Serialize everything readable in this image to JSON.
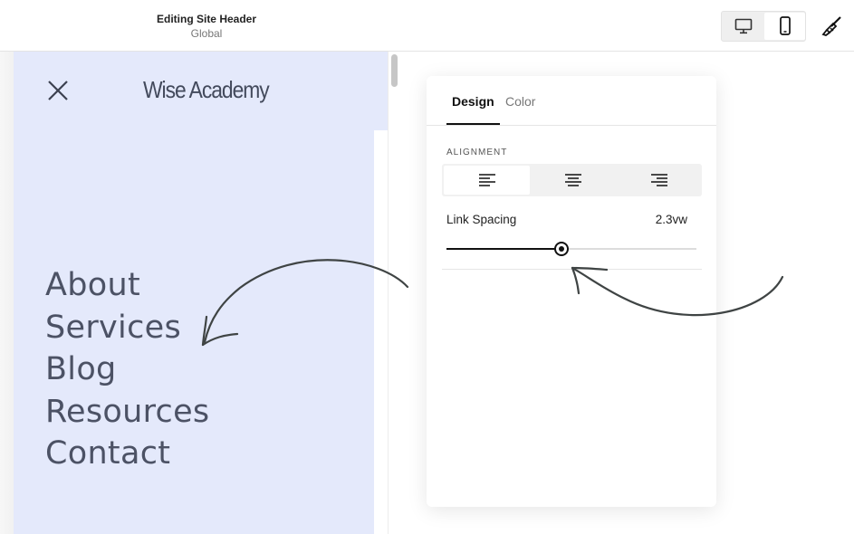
{
  "topbar": {
    "title": "Editing Site Header",
    "subtitle": "Global",
    "device_toggle": {
      "options": [
        "desktop-icon",
        "mobile-icon"
      ],
      "selected": "mobile"
    },
    "style_icon": "paintbrush-icon"
  },
  "preview": {
    "logo": "Wise Academy",
    "close_icon": "close-icon",
    "nav_links": [
      "About",
      "Services",
      "Blog",
      "Resources",
      "Contact"
    ],
    "background_color": "#e4e9fb"
  },
  "panel": {
    "tabs": [
      {
        "label": "Design",
        "active": true
      },
      {
        "label": "Color",
        "active": false
      }
    ],
    "alignment": {
      "label": "ALIGNMENT",
      "options": [
        "align-left-icon",
        "align-center-icon",
        "align-right-icon"
      ],
      "selected": "left"
    },
    "link_spacing": {
      "label": "Link Spacing",
      "value_text": "2.3vw",
      "slider_fraction": 0.46
    }
  }
}
